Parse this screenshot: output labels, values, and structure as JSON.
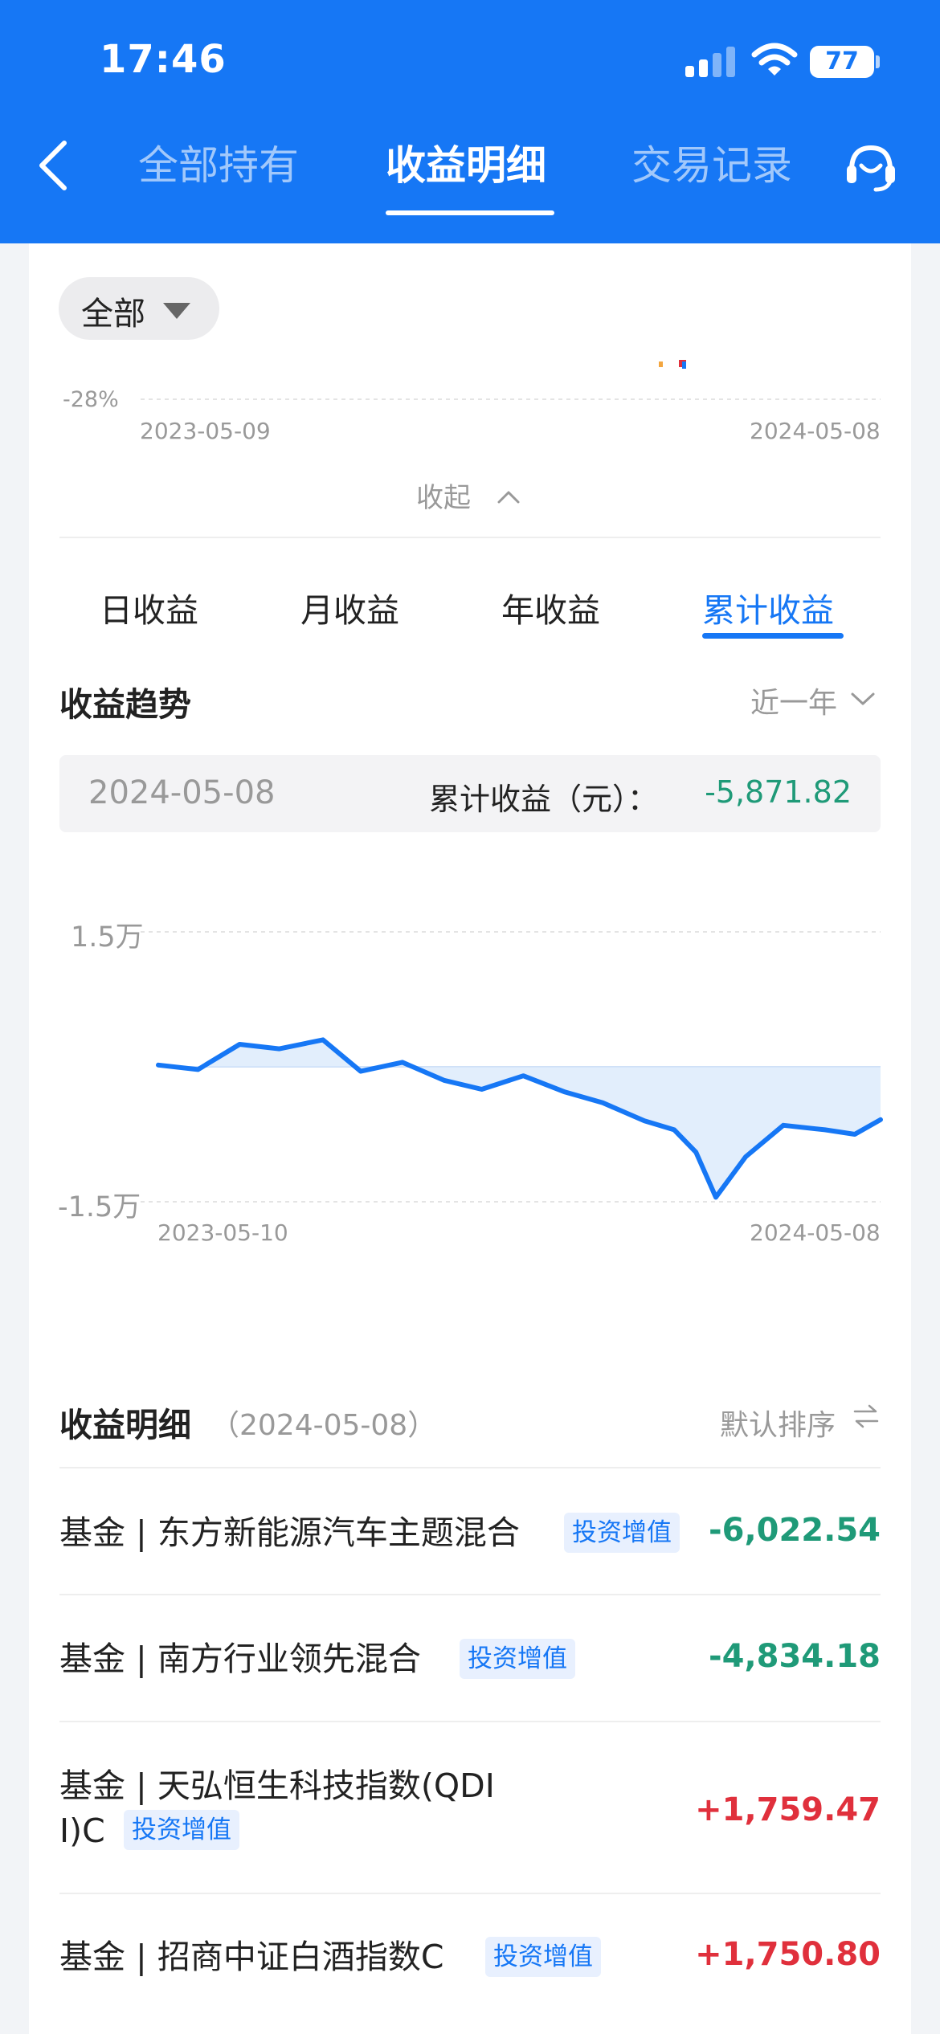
{
  "status_bar": {
    "time": "17:46",
    "battery": "77"
  },
  "nav": {
    "tabs": [
      {
        "label": "全部持有"
      },
      {
        "label": "收益明细"
      },
      {
        "label": "交易记录"
      }
    ],
    "active_tab": "收益明细"
  },
  "filter": {
    "label": "全部"
  },
  "top_chart": {
    "y_label": "-28%",
    "start_date": "2023-05-09",
    "end_date": "2024-05-08"
  },
  "collapse_label": "收起",
  "income_tabs": [
    {
      "label": "日收益"
    },
    {
      "label": "月收益"
    },
    {
      "label": "年收益"
    },
    {
      "label": "累计收益"
    }
  ],
  "active_income_tab": "累计收益",
  "trend": {
    "title": "收益趋势",
    "range": "近一年"
  },
  "summary": {
    "date": "2024-05-08",
    "label": "累计收益（元）：",
    "value": "-5,871.82"
  },
  "chart_data": {
    "type": "area",
    "title": "",
    "y_tick_labels": [
      "1.5万",
      "-1.5万"
    ],
    "ylim": [
      -15000,
      15000
    ],
    "x_start": "2023-05-10",
    "x_end": "2024-05-08",
    "x_dates": [
      "2023-05-10",
      "2023-05-30",
      "2023-06-20",
      "2023-07-10",
      "2023-08-01",
      "2023-08-20",
      "2023-09-10",
      "2023-10-01",
      "2023-10-20",
      "2023-11-10",
      "2023-12-01",
      "2023-12-20",
      "2024-01-10",
      "2024-01-25",
      "2024-02-05",
      "2024-02-15",
      "2024-03-01",
      "2024-03-20",
      "2024-04-10",
      "2024-04-25",
      "2024-05-08"
    ],
    "values": [
      200,
      -300,
      2500,
      2000,
      3000,
      -500,
      500,
      -1500,
      -2500,
      -1000,
      -2800,
      -4000,
      -6000,
      -7000,
      -9500,
      -14500,
      -10000,
      -6500,
      -7000,
      -7500,
      -5871.82
    ],
    "grid": true,
    "area_fill": "#d6e7fb",
    "line_color": "#1677f5"
  },
  "detail": {
    "title": "收益明细",
    "date": "（2024-05-08）",
    "sort": "默认排序",
    "rows": [
      {
        "name": "基金 | 东方新能源汽车主题混合",
        "tag": "投资增值",
        "amount": "-6,022.54"
      },
      {
        "name": "基金 | 南方行业领先混合",
        "tag": "投资增值",
        "amount": "-4,834.18"
      },
      {
        "name_line1": "基金 | 天弘恒生科技指数(QDI",
        "name_line2": "I)C",
        "tag": "投资增值",
        "amount": "+1,759.47"
      },
      {
        "name": "基金 | 招商中证白酒指数C",
        "tag": "投资增值",
        "amount": "+1,750.80"
      }
    ]
  },
  "colors": {
    "header": "#1677f5",
    "loss": "#1f9a78",
    "gain": "#e0303c"
  }
}
